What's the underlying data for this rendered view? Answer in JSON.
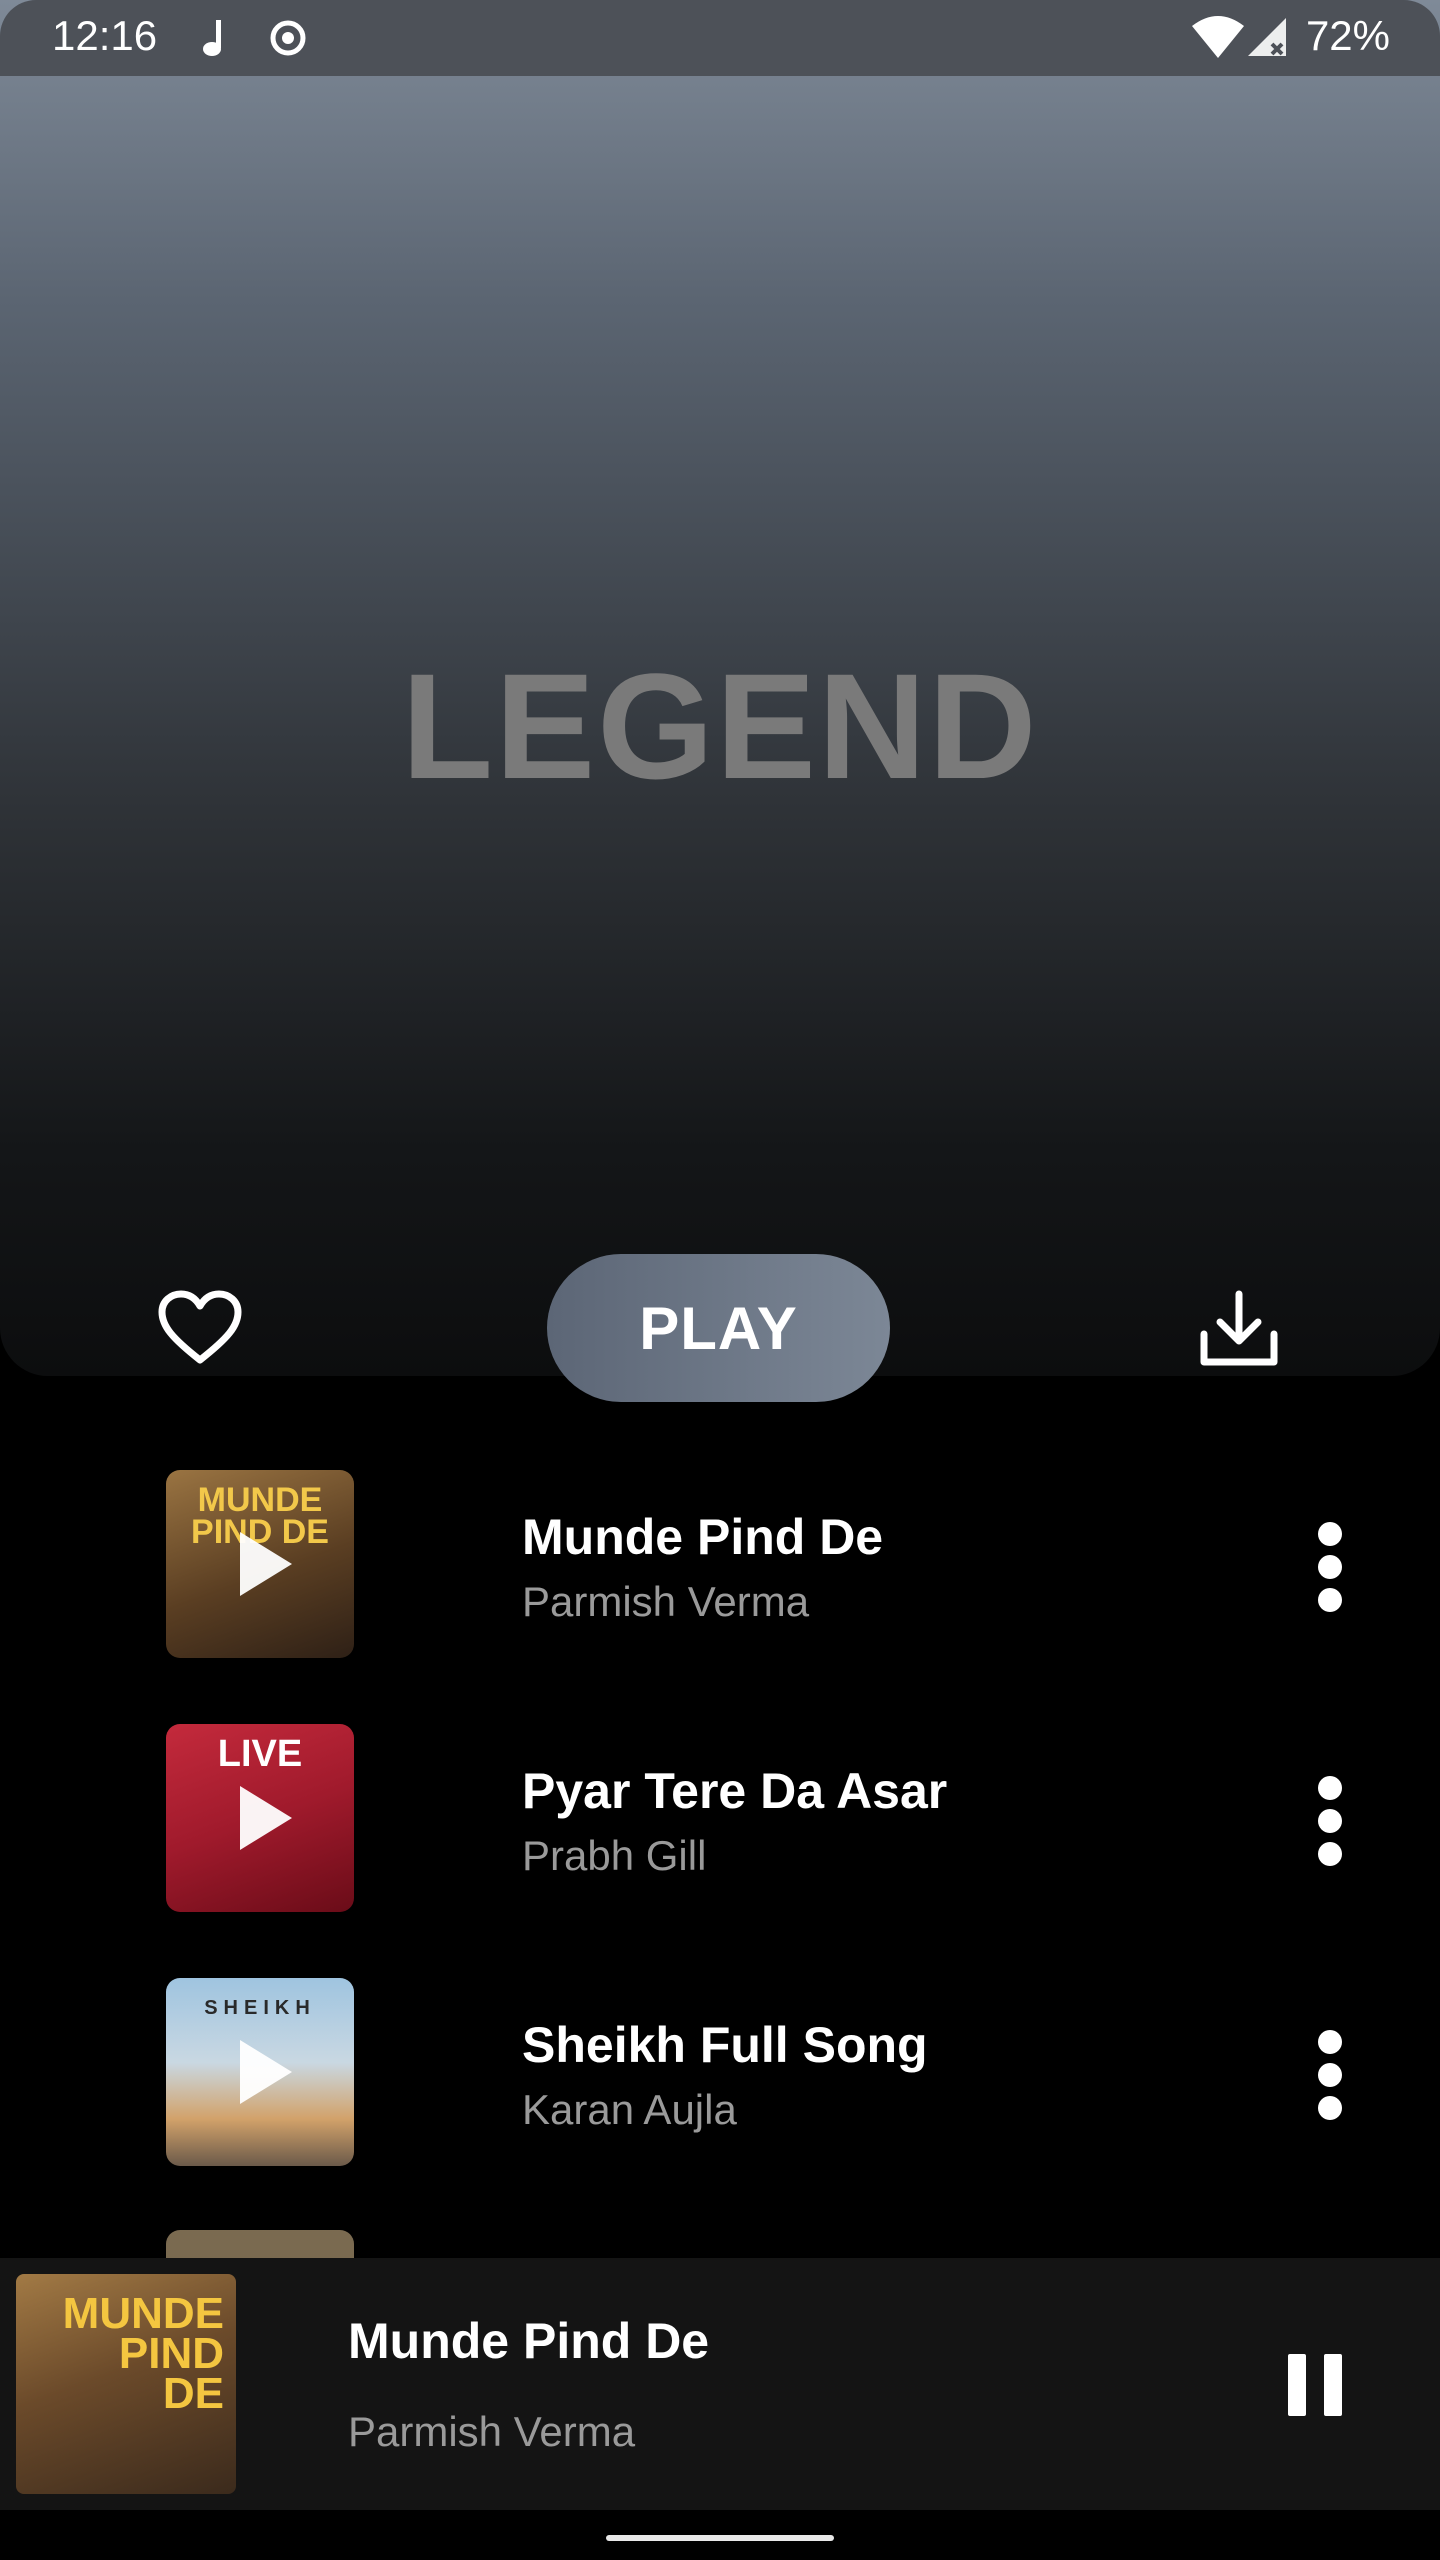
{
  "status_bar": {
    "time": "12:16",
    "battery": "72%",
    "icons": [
      "music-note-icon",
      "record-icon",
      "wifi-icon",
      "cell-signal-icon"
    ]
  },
  "playlist": {
    "title": "LEGEND",
    "play_label": "PLAY",
    "favorite_icon": "heart-outline-icon",
    "download_icon": "download-icon"
  },
  "songs": [
    {
      "title": "Munde Pind De",
      "artist": "Parmish Verma",
      "art_text": "MUNDE PIND DE",
      "colors": [
        "#8a6a3e",
        "#3a2a1a"
      ]
    },
    {
      "title": "Pyar Tere Da Asar",
      "artist": "Prabh Gill",
      "art_text": "LIVE",
      "colors": [
        "#c8283a",
        "#7a1020"
      ]
    },
    {
      "title": "Sheikh Full Song",
      "artist": "Karan Aujla",
      "art_text": "SHEIKH",
      "colors": [
        "#a9c8de",
        "#d8b27a"
      ]
    }
  ],
  "now_playing": {
    "title": "Munde Pind De",
    "artist": "Parmish Verma",
    "art_text": "MUNDE PIND DE"
  }
}
